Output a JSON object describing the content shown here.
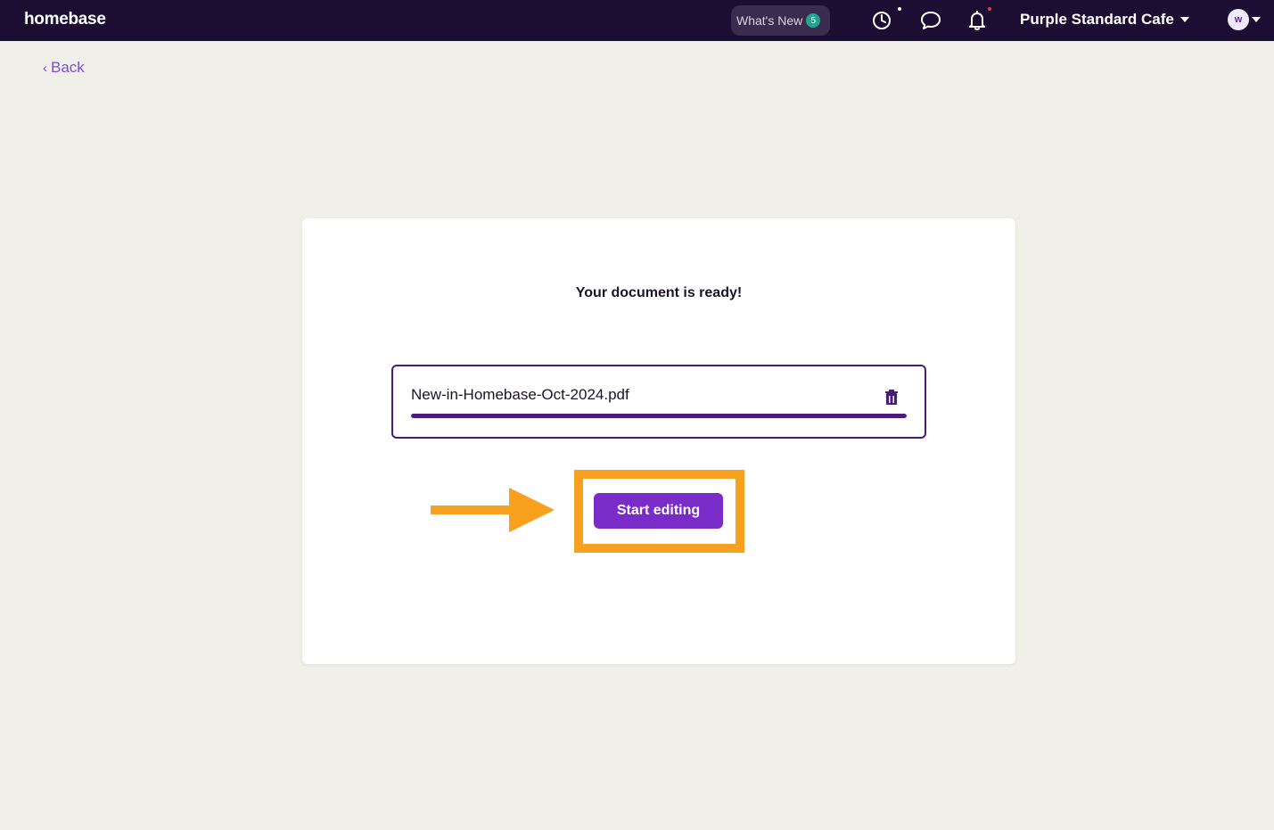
{
  "app": {
    "logo": "homebase"
  },
  "header": {
    "whats_new_label": "What's New",
    "whats_new_count": "5",
    "location_name": "Purple Standard Cafe",
    "avatar_initials": "w",
    "icons": [
      "timeclock-icon",
      "chat-icon",
      "bell-icon"
    ]
  },
  "nav": {
    "back_label": "Back"
  },
  "card": {
    "title": "Your document is ready!",
    "file_name": "New-in-Homebase-Oct-2024.pdf",
    "upload_progress": 1.0,
    "start_button_label": "Start editing"
  },
  "colors": {
    "topbar": "#1c0d33",
    "accent": "#7a2cc8",
    "highlight": "#f7a11e",
    "badge": "#22a58f"
  }
}
